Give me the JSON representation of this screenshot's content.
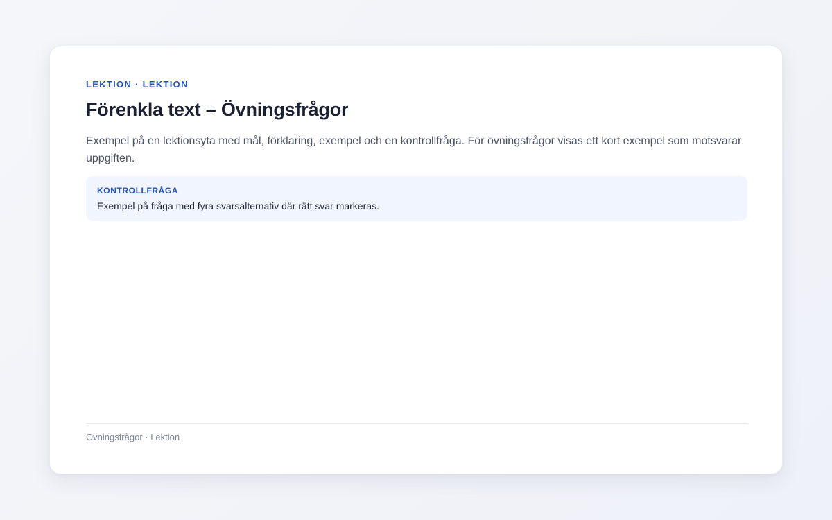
{
  "lesson": {
    "eyebrow": "Lektion · Lektion",
    "title": "Förenkla text – Övningsfrågor",
    "intro": "Exempel på en lektionsyta med mål, förklaring, exempel och en kontrollfråga. För övningsfrågor visas ett kort exempel som motsvarar uppgiften.",
    "callout": {
      "label": "Kontrollfråga",
      "text": "Exempel på fråga med fyra svarsalternativ där rätt svar markeras."
    },
    "footer": "Övningsfrågor · Lektion"
  },
  "colors": {
    "accent": "#2352c4",
    "title": "#1b2130",
    "body_text": "#4a5163",
    "callout_bg": "#f0f5ff",
    "footer_text": "#7c8496"
  }
}
